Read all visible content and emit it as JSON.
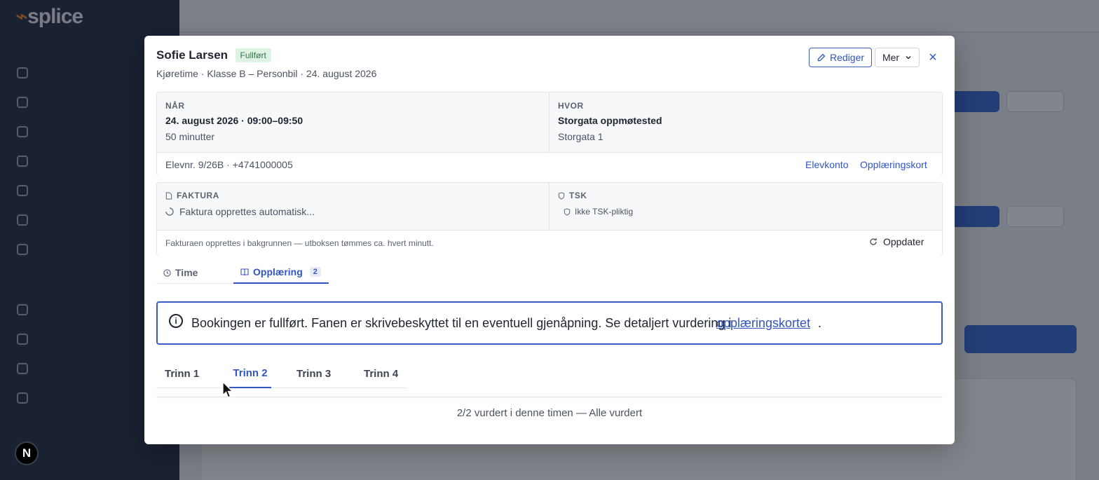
{
  "modal": {
    "student_name": "Sofie Larsen",
    "status": "Fullført",
    "subtitle": "Kjøretime · Klasse B – Personbil · 24. august 2026",
    "edit_label": "Rediger",
    "more_label": "Mer",
    "close_label": "×",
    "when": {
      "label": "NÅR",
      "datetime": "24. august 2026 · 09:00–09:50",
      "duration": "50 minutter"
    },
    "where": {
      "label": "HVOR",
      "place": "Storgata oppmøtested",
      "address": "Storgata 1"
    },
    "student_meta": "Elevnr. 9/26B  ·  +4741000005",
    "links": {
      "account": "Elevkonto",
      "training_card": "Opplæringskort"
    },
    "invoice": {
      "label": "FAKTURA",
      "status": "Faktura opprettes automatisk...",
      "note": "Fakturaen opprettes i bakgrunnen — utboksen tømmes ca. hvert minutt.",
      "refresh_label": "Oppdater"
    },
    "tsk": {
      "label": "TSK",
      "status": "Ikke TSK-pliktig"
    },
    "tabs": [
      {
        "label": "Time"
      },
      {
        "label": "Opplæring",
        "count": "2"
      }
    ],
    "alert": {
      "text": "Bookingen er fullført. Fanen er skrivebeskyttet til en eventuell gjenåpning. Se detaljert vurdering i",
      "link": "opplæringskortet",
      "suffix": "."
    },
    "steps": [
      "Trinn 1",
      "Trinn 2",
      "Trinn 3",
      "Trinn 4"
    ],
    "summary": "2/2 vurdert i denne timen — Alle vurdert"
  },
  "background": {
    "logo": "splice",
    "n_badge": "N"
  },
  "colors": {
    "accent": "#3156c2",
    "success_bg": "#dff3e4",
    "success_text": "#2e7a43"
  }
}
